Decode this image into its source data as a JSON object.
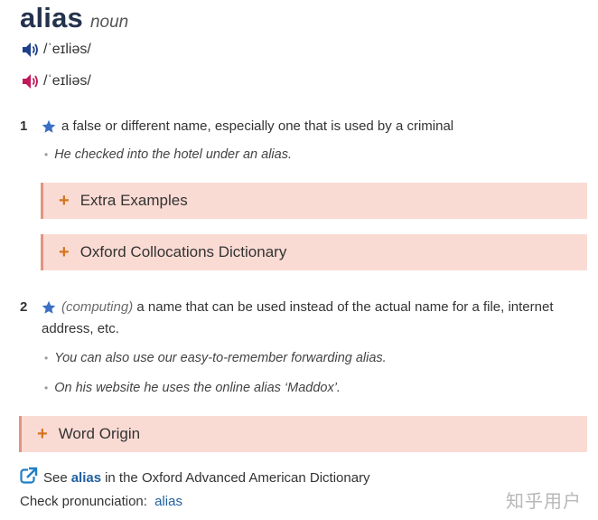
{
  "entry": {
    "headword": "alias",
    "part_of_speech": "noun",
    "pronunciations": [
      {
        "ipa": "/ˈeɪliəs/",
        "icon": "speaker-icon",
        "color": "#1e3f8c"
      },
      {
        "ipa": "/ˈeɪliəs/",
        "icon": "speaker-icon",
        "color": "#c2185b"
      }
    ]
  },
  "senses": [
    {
      "number": "1",
      "definition": "a false or different name, especially one that is used by a criminal",
      "examples": [
        "He checked into the hotel under an alias."
      ]
    },
    {
      "number": "2",
      "label": "(computing)",
      "definition_line1": "a name that can be used instead of the actual name for a file, internet",
      "definition_line2": "address, etc.",
      "examples": [
        "You can also use our easy-to-remember forwarding alias.",
        "On his website he uses the online alias ‘Maddox’."
      ]
    }
  ],
  "sections": {
    "extra_examples": "Extra Examples",
    "collocations": "Oxford Collocations Dictionary",
    "word_origin": "Word Origin"
  },
  "footer": {
    "see_prefix": "See",
    "see_word": "alias",
    "see_suffix": "in the Oxford Advanced American Dictionary",
    "check_label": "Check pronunciation:",
    "check_word": "alias"
  },
  "watermark": "知乎用户",
  "colors": {
    "accent_star": "#3a6fc4",
    "plus": "#d5731f",
    "collapse_bg": "#fadbd4",
    "collapse_border": "#e0957e",
    "link": "#1f5fa0"
  }
}
